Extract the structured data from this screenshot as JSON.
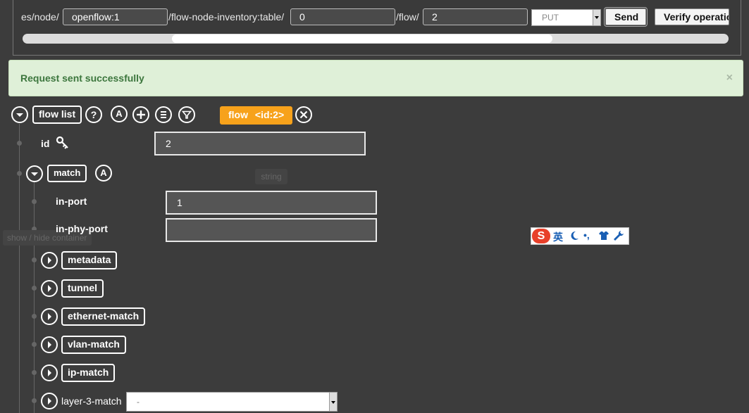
{
  "request": {
    "path_prefix": "es/node/",
    "node_value": "openflow:1",
    "path_mid": "/flow-node-inventory:table/",
    "table_value": "0",
    "path_flow": "/flow/",
    "flow_value": "2",
    "method": "PUT",
    "send_label": "Send",
    "verify_label": "Verify operation"
  },
  "alert": {
    "message": "Request sent successfully",
    "close": "×"
  },
  "tree": {
    "root_label": "flow list",
    "help_glyph": "?",
    "augment_glyph": "A",
    "active_tag_name": "flow",
    "active_tag_id": "<id:2>",
    "id_label": "id",
    "id_value": "2",
    "tooltip_type": "string",
    "tooltip_toggle": "show / hide container",
    "match_label": "match",
    "in_port_label": "in-port",
    "in_port_value": "1",
    "in_phy_port_label": "in-phy-port",
    "in_phy_port_value": "",
    "children": [
      "metadata",
      "tunnel",
      "ethernet-match",
      "vlan-match",
      "ip-match"
    ],
    "layer3_label": "layer-3-match",
    "layer3_value": "-"
  },
  "ime": {
    "logo": "S",
    "lang": "英"
  },
  "colors": {
    "background": "#3c3c3c",
    "alert_bg": "#dff0d8",
    "alert_text": "#3c763d",
    "tag": "#f7a21b"
  }
}
